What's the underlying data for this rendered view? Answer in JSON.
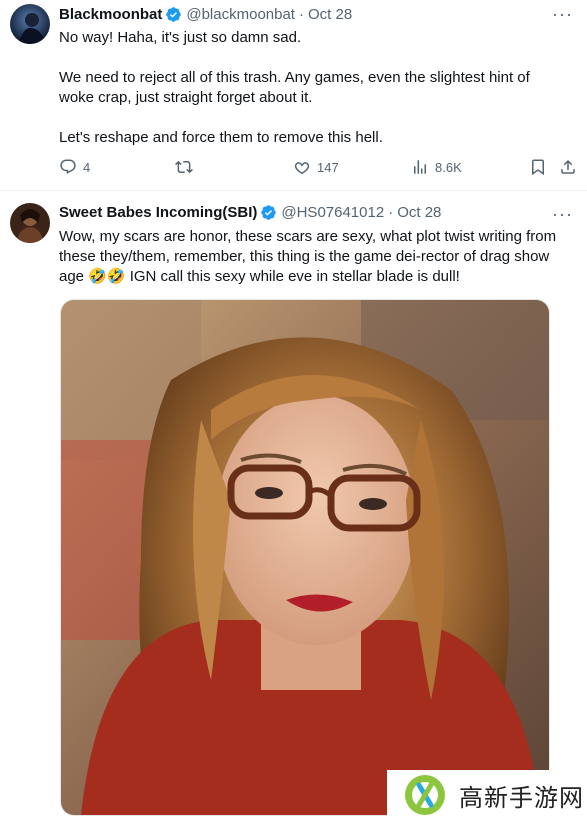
{
  "tweets": [
    {
      "author": "Blackmoonbat",
      "handle": "@blackmoonbat",
      "date": "Oct 28",
      "body": [
        "No way! Haha, it's just so damn sad.",
        "We need to reject all of this trash. Any games, even the slightest hint of woke crap, just straight forget about it.",
        "Let's reshape and force them to remove this hell."
      ],
      "replies": "4",
      "reposts": "",
      "likes": "147",
      "views": "8.6K"
    },
    {
      "author": "Sweet Babes Incoming(SBI)",
      "handle": "@HS07641012",
      "date": "Oct 28",
      "body": "Wow, my scars are honor, these scars are sexy, what plot twist writing from these they/them, remember, this thing is the game dei-rector of drag show age 🤣🤣 IGN call this sexy while eve in stellar blade is dull!"
    }
  ],
  "separator": "·",
  "more_glyph": "···",
  "watermark": "高新手游网",
  "colors": {
    "verified": "#1d9bf0",
    "meta": "#536471",
    "text": "#0f1419"
  }
}
